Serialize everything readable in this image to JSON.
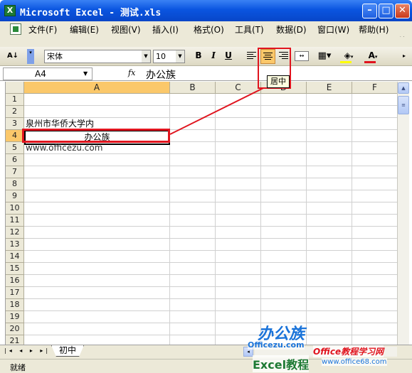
{
  "window": {
    "title": "Microsoft Excel - 测试.xls"
  },
  "menu": {
    "items": [
      "文件(F)",
      "编辑(E)",
      "视图(V)",
      "插入(I)",
      "格式(O)",
      "工具(T)",
      "数据(D)",
      "窗口(W)",
      "帮助(H)"
    ]
  },
  "toolbar": {
    "font_name": "宋体",
    "font_size": "10",
    "bold": "B",
    "italic": "I",
    "underline": "U",
    "font_color_label": "A",
    "tooltip": "居中"
  },
  "formula_bar": {
    "name_box": "A4",
    "fx": "fx",
    "content": "办公族"
  },
  "grid": {
    "columns": [
      "A",
      "B",
      "C",
      "D",
      "E",
      "F"
    ],
    "selected_col": "A",
    "selected_row": "4",
    "rows": [
      "1",
      "2",
      "3",
      "4",
      "5",
      "6",
      "7",
      "8",
      "9",
      "10",
      "11",
      "12",
      "13",
      "14",
      "15",
      "16",
      "17",
      "18",
      "19",
      "20",
      "21"
    ],
    "cells": {
      "A3": "泉州市华侨大学内",
      "A4": "办公族",
      "A5": "www.officezu.com"
    }
  },
  "sheet_tabs": [
    "初中"
  ],
  "status": {
    "text": "就绪"
  },
  "watermark": {
    "logo": "办公族",
    "logo_sub": "Officezu.com",
    "excel_tutorial": "Excel教程",
    "site": "Office教程学习网",
    "url": "www.office68.com"
  },
  "colors": {
    "title_bar": "#0a55e0",
    "highlight_red": "#e0141e",
    "header_selected": "#fbc86a",
    "watermark_blue": "#1a73d9",
    "watermark_red": "#e0141e"
  }
}
